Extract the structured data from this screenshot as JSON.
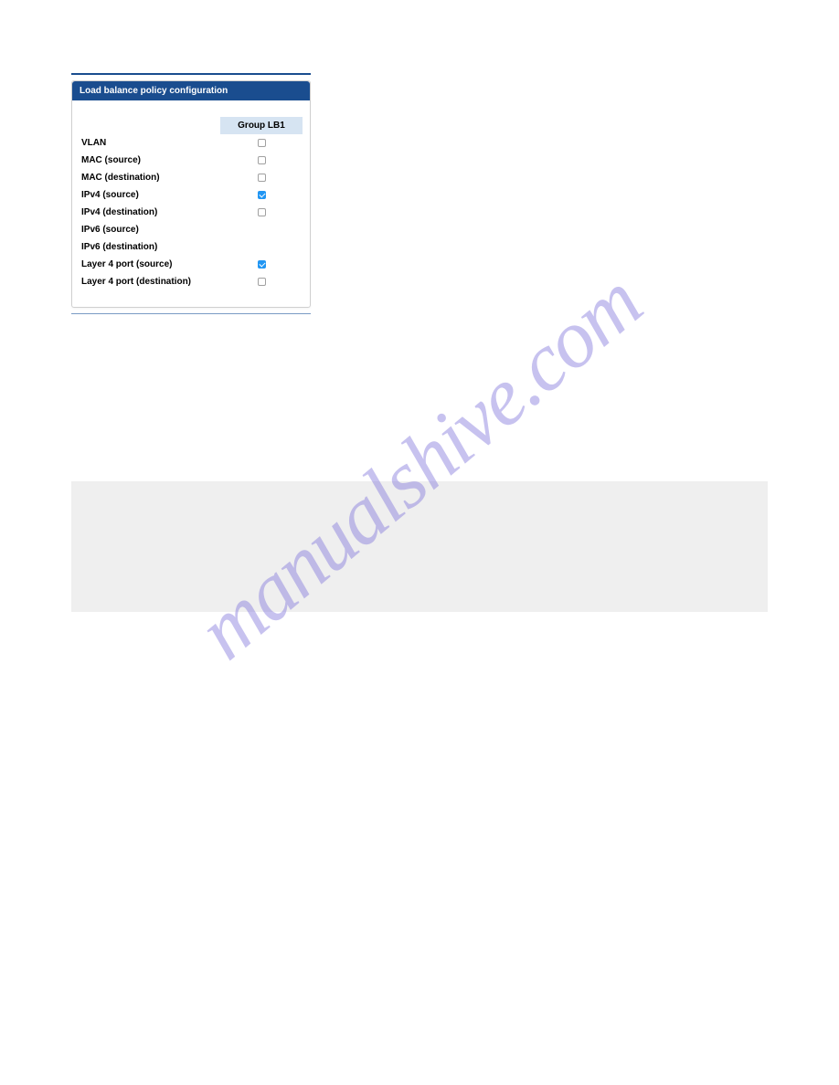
{
  "watermark": "manualshive.com",
  "panel": {
    "title": "Load balance policy configuration",
    "group_header": "Group LB1",
    "rows": [
      {
        "label": "VLAN",
        "checked": false,
        "has_checkbox": true
      },
      {
        "label": "MAC (source)",
        "checked": false,
        "has_checkbox": true
      },
      {
        "label": "MAC (destination)",
        "checked": false,
        "has_checkbox": true
      },
      {
        "label": "IPv4 (source)",
        "checked": true,
        "has_checkbox": true
      },
      {
        "label": "IPv4 (destination)",
        "checked": false,
        "has_checkbox": true
      },
      {
        "label": "IPv6 (source)",
        "checked": false,
        "has_checkbox": false
      },
      {
        "label": "IPv6 (destination)",
        "checked": false,
        "has_checkbox": false
      },
      {
        "label": "Layer 4 port (source)",
        "checked": true,
        "has_checkbox": true
      },
      {
        "label": "Layer 4 port (destination)",
        "checked": false,
        "has_checkbox": true
      }
    ]
  }
}
